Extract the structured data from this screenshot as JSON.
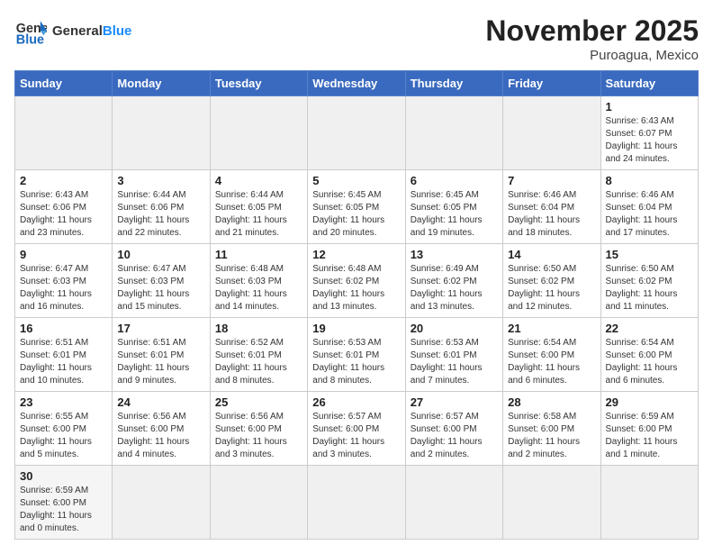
{
  "header": {
    "logo_general": "General",
    "logo_blue": "Blue",
    "month_title": "November 2025",
    "location": "Puroagua, Mexico"
  },
  "days_of_week": [
    "Sunday",
    "Monday",
    "Tuesday",
    "Wednesday",
    "Thursday",
    "Friday",
    "Saturday"
  ],
  "weeks": [
    [
      {
        "day": "",
        "info": ""
      },
      {
        "day": "",
        "info": ""
      },
      {
        "day": "",
        "info": ""
      },
      {
        "day": "",
        "info": ""
      },
      {
        "day": "",
        "info": ""
      },
      {
        "day": "",
        "info": ""
      },
      {
        "day": "1",
        "info": "Sunrise: 6:43 AM\nSunset: 6:07 PM\nDaylight: 11 hours\nand 24 minutes."
      }
    ],
    [
      {
        "day": "2",
        "info": "Sunrise: 6:43 AM\nSunset: 6:06 PM\nDaylight: 11 hours\nand 23 minutes."
      },
      {
        "day": "3",
        "info": "Sunrise: 6:44 AM\nSunset: 6:06 PM\nDaylight: 11 hours\nand 22 minutes."
      },
      {
        "day": "4",
        "info": "Sunrise: 6:44 AM\nSunset: 6:05 PM\nDaylight: 11 hours\nand 21 minutes."
      },
      {
        "day": "5",
        "info": "Sunrise: 6:45 AM\nSunset: 6:05 PM\nDaylight: 11 hours\nand 20 minutes."
      },
      {
        "day": "6",
        "info": "Sunrise: 6:45 AM\nSunset: 6:05 PM\nDaylight: 11 hours\nand 19 minutes."
      },
      {
        "day": "7",
        "info": "Sunrise: 6:46 AM\nSunset: 6:04 PM\nDaylight: 11 hours\nand 18 minutes."
      },
      {
        "day": "8",
        "info": "Sunrise: 6:46 AM\nSunset: 6:04 PM\nDaylight: 11 hours\nand 17 minutes."
      }
    ],
    [
      {
        "day": "9",
        "info": "Sunrise: 6:47 AM\nSunset: 6:03 PM\nDaylight: 11 hours\nand 16 minutes."
      },
      {
        "day": "10",
        "info": "Sunrise: 6:47 AM\nSunset: 6:03 PM\nDaylight: 11 hours\nand 15 minutes."
      },
      {
        "day": "11",
        "info": "Sunrise: 6:48 AM\nSunset: 6:03 PM\nDaylight: 11 hours\nand 14 minutes."
      },
      {
        "day": "12",
        "info": "Sunrise: 6:48 AM\nSunset: 6:02 PM\nDaylight: 11 hours\nand 13 minutes."
      },
      {
        "day": "13",
        "info": "Sunrise: 6:49 AM\nSunset: 6:02 PM\nDaylight: 11 hours\nand 13 minutes."
      },
      {
        "day": "14",
        "info": "Sunrise: 6:50 AM\nSunset: 6:02 PM\nDaylight: 11 hours\nand 12 minutes."
      },
      {
        "day": "15",
        "info": "Sunrise: 6:50 AM\nSunset: 6:02 PM\nDaylight: 11 hours\nand 11 minutes."
      }
    ],
    [
      {
        "day": "16",
        "info": "Sunrise: 6:51 AM\nSunset: 6:01 PM\nDaylight: 11 hours\nand 10 minutes."
      },
      {
        "day": "17",
        "info": "Sunrise: 6:51 AM\nSunset: 6:01 PM\nDaylight: 11 hours\nand 9 minutes."
      },
      {
        "day": "18",
        "info": "Sunrise: 6:52 AM\nSunset: 6:01 PM\nDaylight: 11 hours\nand 8 minutes."
      },
      {
        "day": "19",
        "info": "Sunrise: 6:53 AM\nSunset: 6:01 PM\nDaylight: 11 hours\nand 8 minutes."
      },
      {
        "day": "20",
        "info": "Sunrise: 6:53 AM\nSunset: 6:01 PM\nDaylight: 11 hours\nand 7 minutes."
      },
      {
        "day": "21",
        "info": "Sunrise: 6:54 AM\nSunset: 6:00 PM\nDaylight: 11 hours\nand 6 minutes."
      },
      {
        "day": "22",
        "info": "Sunrise: 6:54 AM\nSunset: 6:00 PM\nDaylight: 11 hours\nand 6 minutes."
      }
    ],
    [
      {
        "day": "23",
        "info": "Sunrise: 6:55 AM\nSunset: 6:00 PM\nDaylight: 11 hours\nand 5 minutes."
      },
      {
        "day": "24",
        "info": "Sunrise: 6:56 AM\nSunset: 6:00 PM\nDaylight: 11 hours\nand 4 minutes."
      },
      {
        "day": "25",
        "info": "Sunrise: 6:56 AM\nSunset: 6:00 PM\nDaylight: 11 hours\nand 3 minutes."
      },
      {
        "day": "26",
        "info": "Sunrise: 6:57 AM\nSunset: 6:00 PM\nDaylight: 11 hours\nand 3 minutes."
      },
      {
        "day": "27",
        "info": "Sunrise: 6:57 AM\nSunset: 6:00 PM\nDaylight: 11 hours\nand 2 minutes."
      },
      {
        "day": "28",
        "info": "Sunrise: 6:58 AM\nSunset: 6:00 PM\nDaylight: 11 hours\nand 2 minutes."
      },
      {
        "day": "29",
        "info": "Sunrise: 6:59 AM\nSunset: 6:00 PM\nDaylight: 11 hours\nand 1 minute."
      }
    ],
    [
      {
        "day": "30",
        "info": "Sunrise: 6:59 AM\nSunset: 6:00 PM\nDaylight: 11 hours\nand 0 minutes."
      },
      {
        "day": "",
        "info": ""
      },
      {
        "day": "",
        "info": ""
      },
      {
        "day": "",
        "info": ""
      },
      {
        "day": "",
        "info": ""
      },
      {
        "day": "",
        "info": ""
      },
      {
        "day": "",
        "info": ""
      }
    ]
  ]
}
